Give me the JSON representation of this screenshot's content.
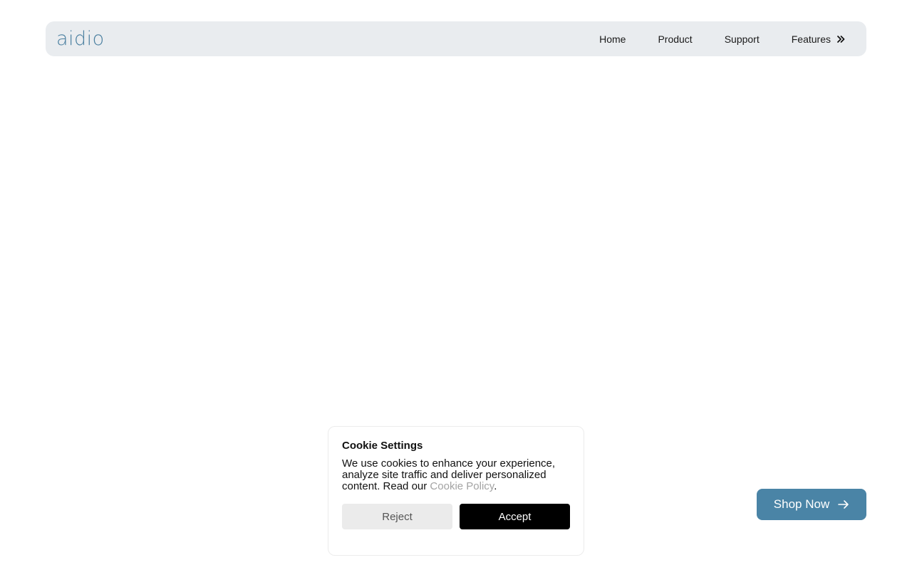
{
  "navbar": {
    "logo": "aidio",
    "links": [
      {
        "label": "Home"
      },
      {
        "label": "Product"
      },
      {
        "label": "Support"
      },
      {
        "label": "Features"
      }
    ]
  },
  "cookie": {
    "title": "Cookie Settings",
    "text": "We use cookies to enhance your experience, analyze site traffic and deliver personalized content. Read our ",
    "link": "Cookie Policy",
    "text_end": ".",
    "reject": "Reject",
    "accept": "Accept"
  },
  "shop": {
    "label": "Shop Now"
  },
  "icons": {
    "features": "chevron-double-right-icon",
    "shop": "arrow-right-icon"
  },
  "colors": {
    "brand": "#4a7fa0",
    "shop_button": "#4a84a6",
    "navbar_bg": "#e9ecef",
    "accept_bg": "#000000",
    "reject_bg": "#ebebeb"
  }
}
